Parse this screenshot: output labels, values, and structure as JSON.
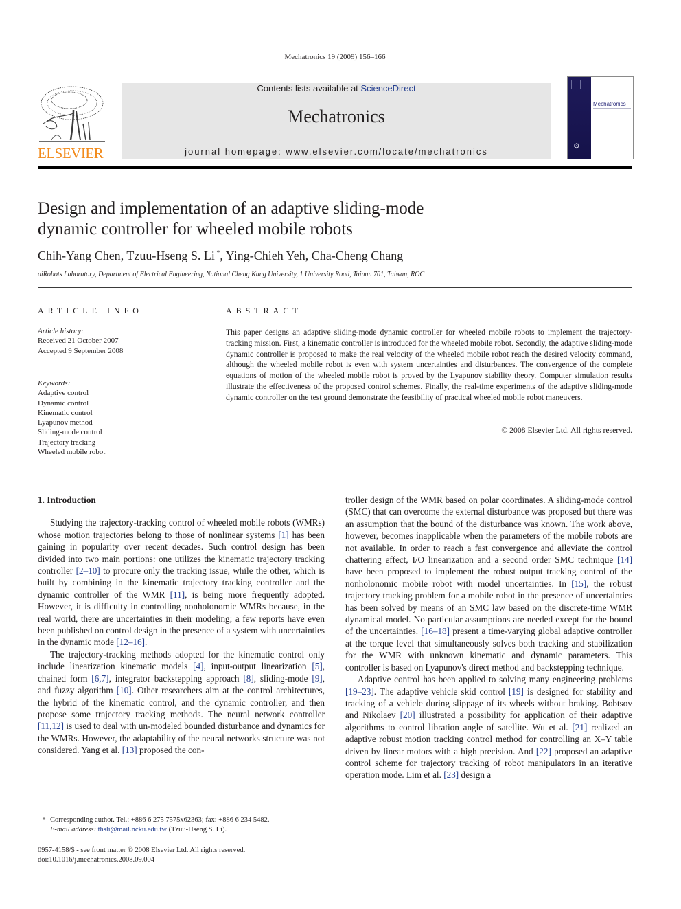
{
  "header": {
    "citation": "Mechatronics 19 (2009) 156–166",
    "publisher_logo_text": "ELSEVIER",
    "contents_prefix": "Contents lists available at ",
    "contents_link": "ScienceDirect",
    "journal_title": "Mechatronics",
    "homepage": "journal homepage: www.elsevier.com/locate/mechatronics",
    "cover_title": "Mechatronics",
    "brand_orange": "#f28b1c",
    "link_blue": "#243e8f"
  },
  "article": {
    "title_line1": "Design and implementation of an adaptive sliding-mode",
    "title_line2": "dynamic controller for wheeled mobile robots",
    "authors": [
      {
        "name": "Chih-Yang Chen",
        "sep": ", "
      },
      {
        "name": "Tzuu-Hseng S. Li",
        "mark": "*",
        "sep": ", "
      },
      {
        "name": "Ying-Chieh Yeh",
        "sep": ", "
      },
      {
        "name": "Cha-Cheng Chang",
        "sep": ""
      }
    ],
    "affiliation": "aiRobots Laboratory, Department of Electrical Engineering, National Cheng Kung University, 1 University Road, Tainan 701, Taiwan, ROC"
  },
  "article_info": {
    "heading": "ARTICLE INFO",
    "history_label": "Article history:",
    "received": "Received 21 October 2007",
    "accepted": "Accepted 9 September 2008",
    "keywords_label": "Keywords:",
    "keywords": [
      "Adaptive control",
      "Dynamic control",
      "Kinematic control",
      "Lyapunov method",
      "Sliding-mode control",
      "Trajectory tracking",
      "Wheeled mobile robot"
    ]
  },
  "abstract": {
    "heading": "ABSTRACT",
    "text": "This paper designs an adaptive sliding-mode dynamic controller for wheeled mobile robots to implement the trajectory-tracking mission. First, a kinematic controller is introduced for the wheeled mobile robot. Secondly, the adaptive sliding-mode dynamic controller is proposed to make the real velocity of the wheeled mobile robot reach the desired velocity command, although the wheeled mobile robot is even with system uncertainties and disturbances. The convergence of the complete equations of motion of the wheeled mobile robot is proved by the Lyapunov stability theory. Computer simulation results illustrate the effectiveness of the proposed control schemes. Finally, the real-time experiments of the adaptive sliding-mode dynamic controller on the test ground demonstrate the feasibility of practical wheeled mobile robot maneuvers.",
    "copyright": "© 2008 Elsevier Ltd. All rights reserved."
  },
  "body": {
    "section_heading": "1. Introduction",
    "left_paragraphs": [
      {
        "indent": true,
        "segments": [
          {
            "t": "Studying the trajectory-tracking control of wheeled mobile robots (WMRs) whose motion trajectories belong to those of nonlinear systems "
          },
          {
            "r": "[1]"
          },
          {
            "t": " has been gaining in popularity over recent decades. Such control design has been divided into two main portions: one utilizes the kinematic trajectory tracking controller "
          },
          {
            "r": "[2–10]"
          },
          {
            "t": " to procure only the tracking issue, while the other, which is built by combining in the kinematic trajectory tracking controller and the dynamic controller of the WMR "
          },
          {
            "r": "[11]"
          },
          {
            "t": ", is being more frequently adopted. However, it is difficulty in controlling nonholonomic WMRs because, in the real world, there are uncertainties in their modeling; a few reports have even been published on control design in the presence of a system with uncertainties in the dynamic mode "
          },
          {
            "r": "[12–16]"
          },
          {
            "t": "."
          }
        ]
      },
      {
        "indent": true,
        "segments": [
          {
            "t": "The trajectory-tracking methods adopted for the kinematic control only include linearization kinematic models "
          },
          {
            "r": "[4]"
          },
          {
            "t": ", input-output linearization "
          },
          {
            "r": "[5]"
          },
          {
            "t": ", chained form "
          },
          {
            "r": "[6,7]"
          },
          {
            "t": ", integrator backstepping approach "
          },
          {
            "r": "[8]"
          },
          {
            "t": ", sliding-mode "
          },
          {
            "r": "[9]"
          },
          {
            "t": ", and fuzzy algorithm "
          },
          {
            "r": "[10]"
          },
          {
            "t": ". Other researchers aim at the control architectures, the hybrid of the kinematic control, and the dynamic controller, and then propose some trajectory tracking methods. The neural network controller "
          },
          {
            "r": "[11,12]"
          },
          {
            "t": " is used to deal with un-modeled bounded disturbance and dynamics for the WMRs. However, the adaptability of the neural networks structure was not considered. Yang et al. "
          },
          {
            "r": "[13]"
          },
          {
            "t": " proposed the con-"
          }
        ]
      }
    ],
    "right_paragraphs": [
      {
        "indent": false,
        "segments": [
          {
            "t": "troller design of the WMR based on polar coordinates. A sliding-mode control (SMC) that can overcome the external disturbance was proposed but there was an assumption that the bound of the disturbance was known. The work above, however, becomes inapplicable when the parameters of the mobile robots are not available. In order to reach a fast convergence and alleviate the control chattering effect, I/O linearization and a second order SMC technique "
          },
          {
            "r": "[14]"
          },
          {
            "t": " have been proposed to implement the robust output tracking control of the nonholonomic mobile robot with model uncertainties. In "
          },
          {
            "r": "[15]"
          },
          {
            "t": ", the robust trajectory tracking problem for a mobile robot in the presence of uncertainties has been solved by means of an SMC law based on the discrete-time WMR dynamical model. No particular assumptions are needed except for the bound of the uncertainties. "
          },
          {
            "r": "[16–18]"
          },
          {
            "t": " present a time-varying global adaptive controller at the torque level that simultaneously solves both tracking and stabilization for the WMR with unknown kinematic and dynamic parameters. This controller is based on Lyapunov's direct method and backstepping technique."
          }
        ]
      },
      {
        "indent": true,
        "segments": [
          {
            "t": "Adaptive control has been applied to solving many engineering problems "
          },
          {
            "r": "[19–23]"
          },
          {
            "t": ". The adaptive vehicle skid control "
          },
          {
            "r": "[19]"
          },
          {
            "t": " is designed for stability and tracking of a vehicle during slippage of its wheels without braking. Bobtsov and Nikolaev "
          },
          {
            "r": "[20]"
          },
          {
            "t": " illustrated a possibility for application of their adaptive algorithms to control libration angle of satellite. Wu et al. "
          },
          {
            "r": "[21]"
          },
          {
            "t": " realized an adaptive robust motion tracking control method for controlling an X–Y table driven by linear motors with a high precision. And "
          },
          {
            "r": "[22]"
          },
          {
            "t": " proposed an adaptive control scheme for trajectory tracking of robot manipulators in an iterative operation mode. Lim et al. "
          },
          {
            "r": "[23]"
          },
          {
            "t": " design a"
          }
        ]
      }
    ]
  },
  "footnote": {
    "star": "*",
    "corresponding": "Corresponding author. Tel.: +886 6 275 7575x62363; fax: +886 6 234 5482.",
    "email_label": "E-mail address:",
    "email": "thsli@mail.ncku.edu.tw",
    "email_owner": " (Tzuu-Hseng S. Li)."
  },
  "front_matter": {
    "issn_line": "0957-4158/$ - see front matter © 2008 Elsevier Ltd. All rights reserved.",
    "doi": "doi:10.1016/j.mechatronics.2008.09.004"
  }
}
